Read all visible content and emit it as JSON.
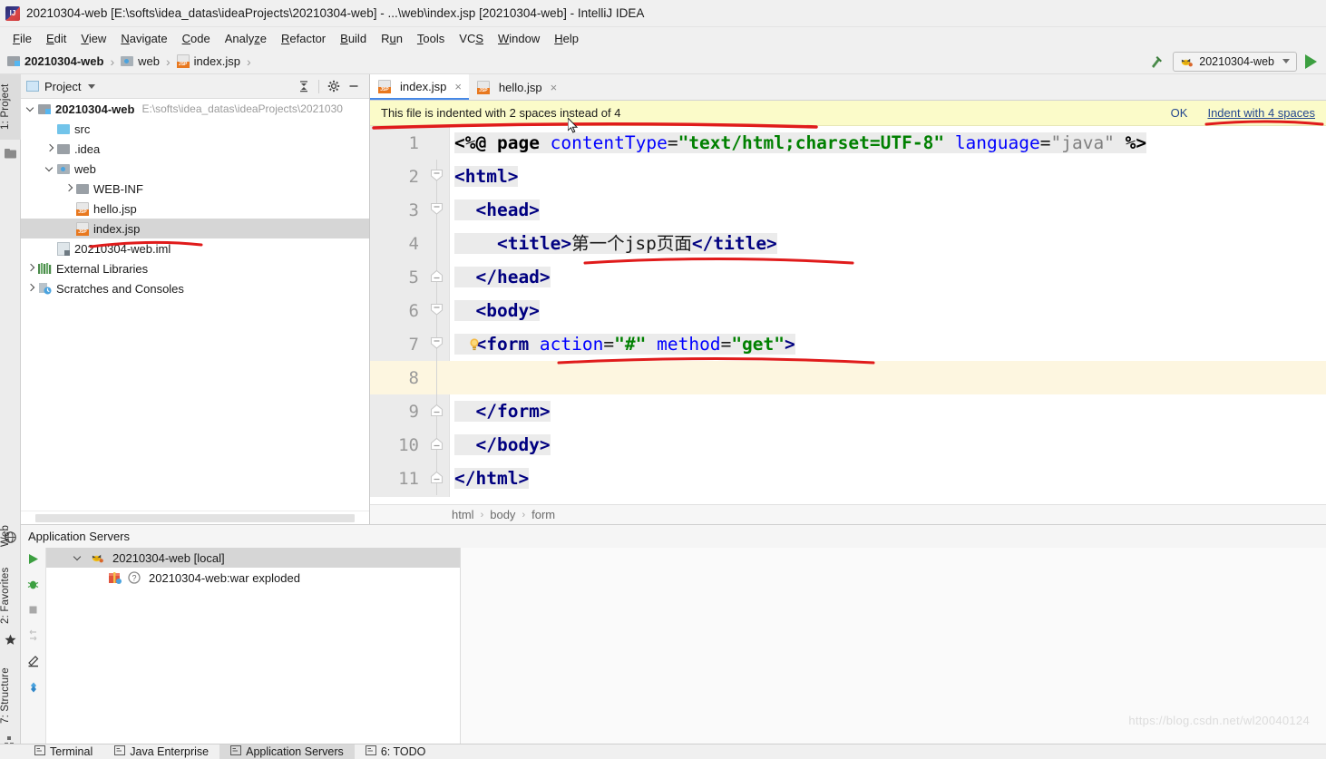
{
  "window": {
    "title": "20210304-web [E:\\softs\\idea_datas\\ideaProjects\\20210304-web] - ...\\web\\index.jsp [20210304-web] - IntelliJ IDEA",
    "app_icon": "intellij-idea-icon"
  },
  "menubar": {
    "items": [
      {
        "label": "File",
        "mnemonic": "F"
      },
      {
        "label": "Edit",
        "mnemonic": "E"
      },
      {
        "label": "View",
        "mnemonic": "V"
      },
      {
        "label": "Navigate",
        "mnemonic": "N"
      },
      {
        "label": "Code",
        "mnemonic": "C"
      },
      {
        "label": "Analyze",
        "mnemonic": "z"
      },
      {
        "label": "Refactor",
        "mnemonic": "R"
      },
      {
        "label": "Build",
        "mnemonic": "B"
      },
      {
        "label": "Run",
        "mnemonic": "u"
      },
      {
        "label": "Tools",
        "mnemonic": "T"
      },
      {
        "label": "VCS",
        "mnemonic": "S"
      },
      {
        "label": "Window",
        "mnemonic": "W"
      },
      {
        "label": "Help",
        "mnemonic": "H"
      }
    ]
  },
  "navbar": {
    "crumbs": [
      {
        "label": "20210304-web",
        "icon": "module-folder-icon",
        "bold": true
      },
      {
        "label": "web",
        "icon": "web-folder-icon",
        "bold": false
      },
      {
        "label": "index.jsp",
        "icon": "jsp-file-icon",
        "bold": false
      }
    ],
    "separator": "›",
    "build_icon": "hammer-build-icon",
    "run_config": {
      "label": "20210304-web",
      "icon": "tomcat-icon"
    },
    "run_button": "run-icon"
  },
  "left_strip": {
    "top_tabs": [
      {
        "label": "1: Project",
        "selected": true
      }
    ],
    "bottom_tabs": [
      {
        "label": "Web",
        "icon": "web-icon"
      },
      {
        "label": "2: Favorites",
        "icon": "star-icon"
      },
      {
        "label": "7: Structure",
        "icon": "structure-icon"
      }
    ]
  },
  "project_panel": {
    "header": {
      "title": "Project",
      "icon": "project-view-icon",
      "caret": "chevron-down-icon",
      "buttons": [
        "collapse-all-icon",
        "settings-gear-icon",
        "hide-panel-icon"
      ]
    },
    "tree": [
      {
        "label": "20210304-web",
        "path": "E:\\softs\\idea_datas\\ideaProjects\\2021030",
        "icon": "module-folder-icon",
        "state": "expanded",
        "indent": 0,
        "bold": true,
        "selected": false
      },
      {
        "label": "src",
        "path": "",
        "icon": "source-folder-icon",
        "state": "leaf",
        "indent": 1,
        "bold": false,
        "selected": false
      },
      {
        "label": ".idea",
        "path": "",
        "icon": "folder-icon",
        "state": "collapsed",
        "indent": 1,
        "bold": false,
        "selected": false
      },
      {
        "label": "web",
        "path": "",
        "icon": "web-folder-icon",
        "state": "expanded",
        "indent": 1,
        "bold": false,
        "selected": false
      },
      {
        "label": "WEB-INF",
        "path": "",
        "icon": "folder-icon",
        "state": "collapsed",
        "indent": 2,
        "bold": false,
        "selected": false
      },
      {
        "label": "hello.jsp",
        "path": "",
        "icon": "jsp-file-icon",
        "state": "leaf",
        "indent": 2,
        "bold": false,
        "selected": false
      },
      {
        "label": "index.jsp",
        "path": "",
        "icon": "jsp-file-icon",
        "state": "leaf",
        "indent": 2,
        "bold": false,
        "selected": true
      },
      {
        "label": "20210304-web.iml",
        "path": "",
        "icon": "iml-file-icon",
        "state": "leaf",
        "indent": 1,
        "bold": false,
        "selected": false
      },
      {
        "label": "External Libraries",
        "path": "",
        "icon": "libraries-icon",
        "state": "collapsed",
        "indent": 0,
        "bold": false,
        "selected": false
      },
      {
        "label": "Scratches and Consoles",
        "path": "",
        "icon": "scratches-icon",
        "state": "collapsed",
        "indent": 0,
        "bold": false,
        "selected": false
      }
    ]
  },
  "editor": {
    "tabs": [
      {
        "label": "index.jsp",
        "icon": "jsp-file-icon",
        "active": true,
        "close": "×"
      },
      {
        "label": "hello.jsp",
        "icon": "jsp-file-icon",
        "active": false,
        "close": "×"
      }
    ],
    "notification": {
      "message": "This file is indented with 2 spaces instead of 4",
      "ok_label": "OK",
      "action_label": "Indent with 4 spaces"
    },
    "highlighted_line": 8,
    "lines": [
      {
        "n": 1,
        "fold": "none",
        "bulb": false,
        "tokens": [
          {
            "t": "<%@ ",
            "c": "dirc"
          },
          {
            "t": "page ",
            "c": "dirc"
          },
          {
            "t": "contentType",
            "c": "attrc"
          },
          {
            "t": "=",
            "c": "plainc"
          },
          {
            "t": "\"text/html;charset=UTF-8\"",
            "c": "strc"
          },
          {
            "t": " ",
            "c": "plainc"
          },
          {
            "t": "language",
            "c": "attrc"
          },
          {
            "t": "=",
            "c": "plainc"
          },
          {
            "t": "\"java\"",
            "c": "grayc"
          },
          {
            "t": " %>",
            "c": "dirc"
          }
        ]
      },
      {
        "n": 2,
        "fold": "open",
        "bulb": false,
        "tokens": [
          {
            "t": "<html>",
            "c": "tagc"
          }
        ]
      },
      {
        "n": 3,
        "fold": "open",
        "bulb": false,
        "tokens": [
          {
            "t": "  <head>",
            "c": "tagc"
          }
        ]
      },
      {
        "n": 4,
        "fold": "none",
        "bulb": false,
        "tokens": [
          {
            "t": "    <title>",
            "c": "tagc"
          },
          {
            "t": "第一个jsp页面",
            "c": "cn"
          },
          {
            "t": "</title>",
            "c": "tagc"
          }
        ]
      },
      {
        "n": 5,
        "fold": "close",
        "bulb": false,
        "tokens": [
          {
            "t": "  </head>",
            "c": "tagc"
          }
        ]
      },
      {
        "n": 6,
        "fold": "open",
        "bulb": false,
        "tokens": [
          {
            "t": "  <body>",
            "c": "tagc"
          }
        ]
      },
      {
        "n": 7,
        "fold": "open",
        "bulb": true,
        "tokens": [
          {
            "t": "  <form ",
            "c": "tagc"
          },
          {
            "t": "action",
            "c": "attrc"
          },
          {
            "t": "=",
            "c": "plainc"
          },
          {
            "t": "\"#\"",
            "c": "strc"
          },
          {
            "t": " ",
            "c": "plainc"
          },
          {
            "t": "method",
            "c": "attrc"
          },
          {
            "t": "=",
            "c": "plainc"
          },
          {
            "t": "\"get\"",
            "c": "strc"
          },
          {
            "t": ">",
            "c": "tagc"
          }
        ]
      },
      {
        "n": 8,
        "fold": "none",
        "bulb": false,
        "tokens": [
          {
            "t": "",
            "c": "plainc"
          }
        ]
      },
      {
        "n": 9,
        "fold": "close",
        "bulb": false,
        "tokens": [
          {
            "t": "  </form>",
            "c": "tagc"
          }
        ]
      },
      {
        "n": 10,
        "fold": "close",
        "bulb": false,
        "tokens": [
          {
            "t": "  </body>",
            "c": "tagc"
          }
        ]
      },
      {
        "n": 11,
        "fold": "close",
        "bulb": false,
        "tokens": [
          {
            "t": "</html>",
            "c": "tagc"
          }
        ]
      }
    ],
    "breadcrumb": {
      "items": [
        "html",
        "body",
        "form"
      ],
      "separator": "›"
    }
  },
  "bottom_panel": {
    "title": "Application Servers",
    "actions": [
      "run-icon",
      "debug-icon",
      "stop-icon",
      "rerun-icon",
      "edit-icon",
      "settings-icon"
    ],
    "rows": [
      {
        "label": "20210304-web [local]",
        "icon": "tomcat-icon",
        "state": "expanded",
        "selected": true,
        "child": false
      },
      {
        "label": "20210304-web:war exploded",
        "icon": "artifact-icon",
        "state": "leaf",
        "selected": false,
        "child": true,
        "badge": "help-icon"
      }
    ]
  },
  "statusbar": {
    "items": [
      {
        "label": "Terminal",
        "icon": "terminal-icon",
        "selected": false
      },
      {
        "label": "Java Enterprise",
        "icon": "java-ee-icon",
        "selected": false
      },
      {
        "label": "Application Servers",
        "icon": "app-servers-icon",
        "selected": true
      },
      {
        "label": "6: TODO",
        "icon": "todo-icon",
        "selected": false
      }
    ]
  },
  "watermark": "https://blog.csdn.net/wl20040124",
  "colors": {
    "notification_bg": "#FBFBC9",
    "accent_link": "#24478F",
    "tag": "#000080",
    "attribute": "#0000FF",
    "string": "#008000",
    "selection": "#D6D6D6",
    "annotation_red": "#E01B1B",
    "run_green": "#3C9F40"
  }
}
